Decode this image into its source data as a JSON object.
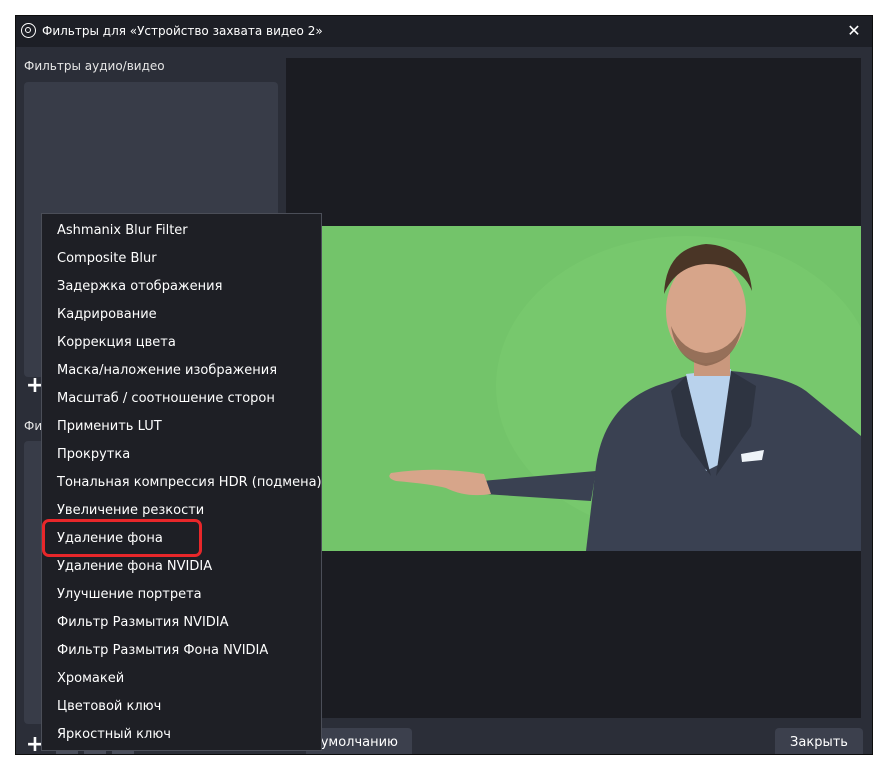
{
  "window": {
    "title": "Фильтры для «Устройство захвата видео 2»",
    "close_label": "✕"
  },
  "left_panel": {
    "label": "Фильтры аудио/видео",
    "label2_visible": "Фи",
    "add_label": "+"
  },
  "buttons": {
    "defaults_label": "умолчанию",
    "close_label": "Закрыть"
  },
  "menu": {
    "items": [
      "Ashmanix Blur Filter",
      "Composite Blur",
      "Задержка отображения",
      "Кадрирование",
      "Коррекция цвета",
      "Маска/наложение изображения",
      "Масштаб / соотношение сторон",
      "Применить LUT",
      "Прокрутка",
      "Тональная компрессия HDR (подмена)",
      "Увеличение резкости",
      "Удаление фона",
      "Удаление фона NVIDIA",
      "Улучшение портрета",
      "Фильтр Размытия NVIDIA",
      "Фильтр Размытия Фона NVIDIA",
      "Хромакей",
      "Цветовой ключ",
      "Яркостный ключ"
    ],
    "highlighted_item": "Удаление фона"
  },
  "colors": {
    "window_bg": "#2b2e38",
    "titlebar_bg": "#1d1f26",
    "menu_bg": "#1e1f25",
    "highlight": "#e8272a",
    "green_screen": "#73c46a"
  }
}
